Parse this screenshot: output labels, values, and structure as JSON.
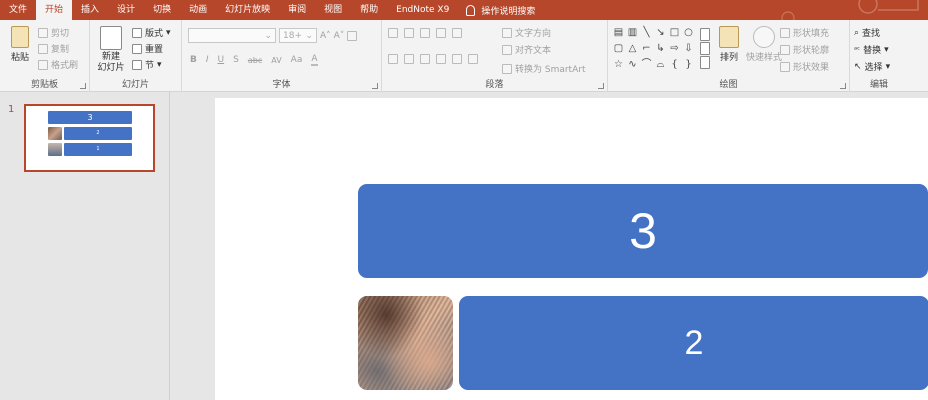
{
  "tabs": [
    {
      "label": "文件",
      "active": false
    },
    {
      "label": "开始",
      "active": true
    },
    {
      "label": "插入",
      "active": false
    },
    {
      "label": "设计",
      "active": false
    },
    {
      "label": "切换",
      "active": false
    },
    {
      "label": "动画",
      "active": false
    },
    {
      "label": "幻灯片放映",
      "active": false
    },
    {
      "label": "审阅",
      "active": false
    },
    {
      "label": "视图",
      "active": false
    },
    {
      "label": "帮助",
      "active": false
    },
    {
      "label": "EndNote X9",
      "active": false
    }
  ],
  "tell_me": "操作说明搜索",
  "clipboard": {
    "label": "剪贴板",
    "paste": "粘贴",
    "cut": "剪切",
    "copy": "复制",
    "format_painter": "格式刷"
  },
  "slides_group": {
    "label": "幻灯片",
    "new_slide": "新建\n幻灯片",
    "layout": "版式",
    "reset": "重置",
    "section": "节"
  },
  "font_group": {
    "label": "字体",
    "font_name": "",
    "font_size": "18+",
    "bold": "B",
    "italic": "I",
    "underline": "U",
    "strike": "S",
    "abc": "abc",
    "spacing": "AV",
    "case": "Aa",
    "color": "A"
  },
  "paragraph_group": {
    "label": "段落",
    "text_direction": "文字方向",
    "align_text": "对齐文本",
    "smartart": "转换为 SmartArt"
  },
  "drawing_group": {
    "label": "绘图",
    "arrange": "排列",
    "quick_styles": "快速样式",
    "shape_fill": "形状填充",
    "shape_outline": "形状轮廓",
    "shape_effects": "形状效果"
  },
  "editing_group": {
    "label": "编辑",
    "find": "查找",
    "replace": "替换",
    "select": "选择"
  },
  "thumbnail": {
    "number": "1",
    "box3": "3",
    "box2": "2",
    "box1": "1"
  },
  "slide": {
    "box_top": "3",
    "box_bottom": "2"
  },
  "colors": {
    "accent": "#b7472a",
    "shape_fill": "#4472c4"
  }
}
